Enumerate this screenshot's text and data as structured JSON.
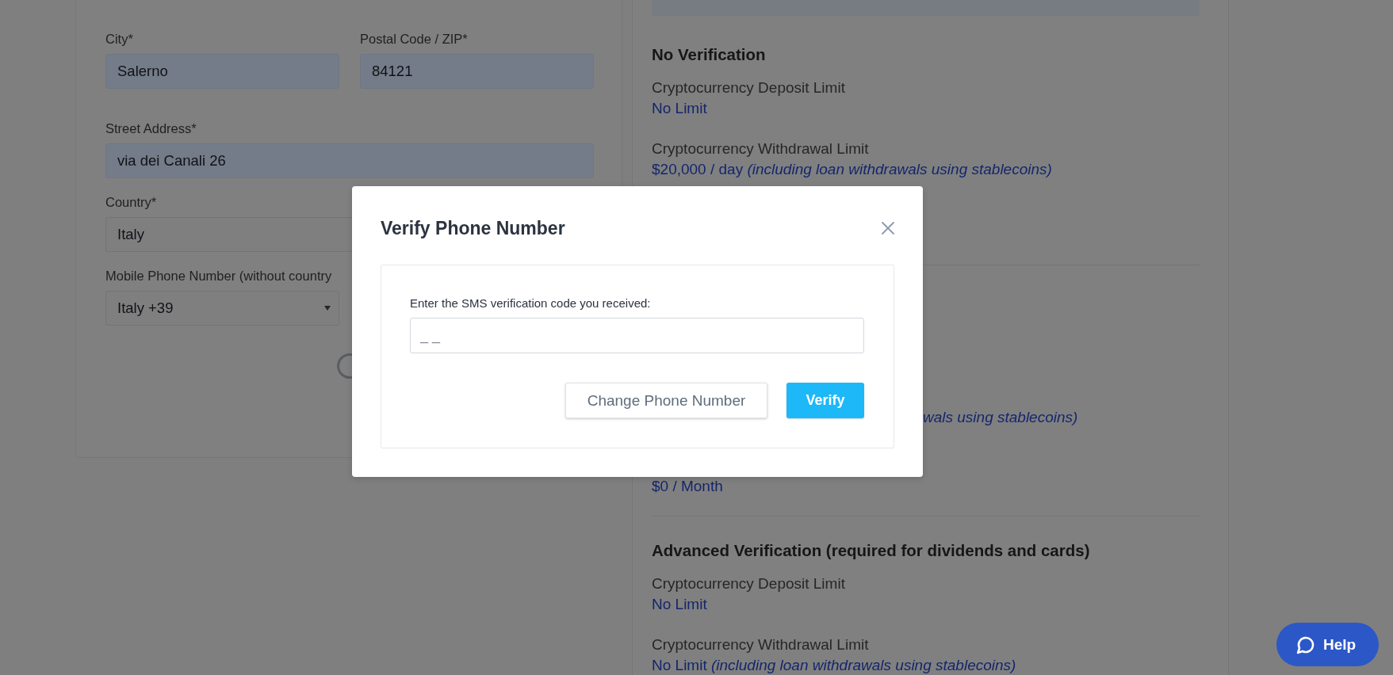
{
  "address_form": {
    "rows": [
      {
        "fields": [
          {
            "label": "City*",
            "value": "Salerno",
            "kind": "input",
            "autofilled": true
          },
          {
            "label": "Postal Code / ZIP*",
            "value": "84121",
            "kind": "input",
            "autofilled": true
          }
        ]
      },
      {
        "fields": [
          {
            "label": "Street Address*",
            "value": "via dei Canali 26",
            "kind": "input",
            "autofilled": true
          }
        ]
      },
      {
        "fields": [
          {
            "label": "Country*",
            "value": "Italy",
            "kind": "input",
            "autofilled": false
          }
        ]
      },
      {
        "fields": [
          {
            "label": "Mobile Phone Number (without country",
            "value": "Italy +39",
            "kind": "select",
            "autofilled": false
          }
        ]
      }
    ]
  },
  "verification_levels": [
    {
      "title": "No Verification",
      "limits": [
        {
          "label": "Cryptocurrency Deposit Limit",
          "value": "No Limit"
        },
        {
          "label": "Cryptocurrency Withdrawal Limit",
          "value": "$20,000 / day *(including loan withdrawals using stablecoins)*"
        }
      ]
    },
    {
      "fragments": [
        {
          "kind": "note",
          "text": "wals using stablecoins)"
        },
        {
          "kind": "value",
          "text": "$0 / Month"
        }
      ]
    },
    {
      "title": "Advanced Verification (required for dividends and cards)",
      "limits": [
        {
          "label": "Cryptocurrency Deposit Limit",
          "value": "No Limit"
        },
        {
          "label": "Cryptocurrency Withdrawal Limit",
          "value": "No Limit *(including loan withdrawals using stablecoins)*"
        }
      ]
    }
  ],
  "modal": {
    "title": "Verify Phone Number",
    "prompt": "Enter the SMS verification code you received:",
    "code_field": {
      "placeholder": "_ _"
    },
    "buttons": [
      {
        "label": "Change Phone Number",
        "kind": "secondary"
      },
      {
        "label": "Verify",
        "kind": "primary"
      }
    ]
  },
  "help_button": {
    "label": "Help"
  }
}
